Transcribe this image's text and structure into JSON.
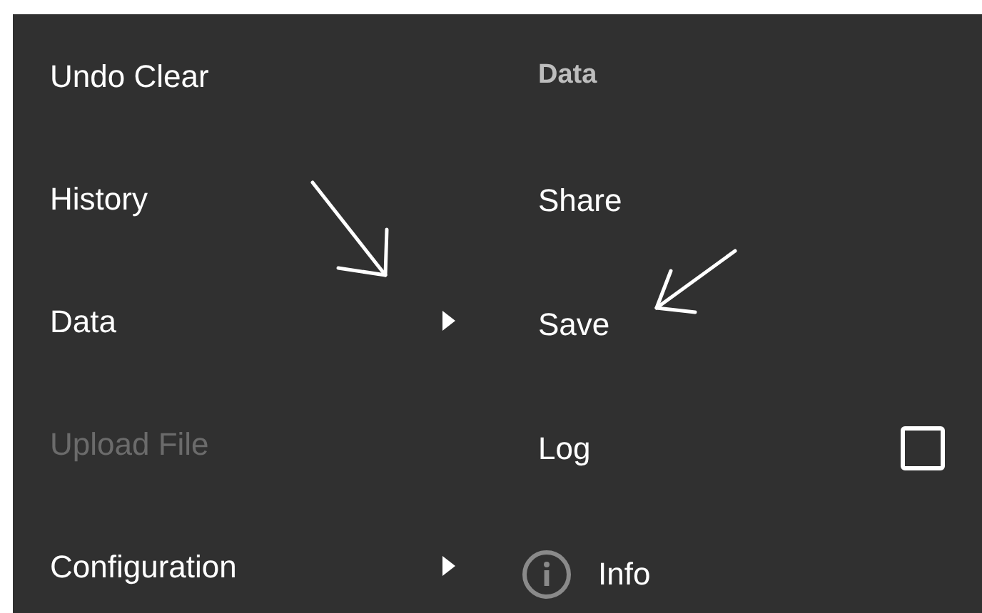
{
  "main_menu": {
    "items": [
      {
        "label": "Undo Clear",
        "kind": "plain",
        "disabled": false
      },
      {
        "label": "History",
        "kind": "plain",
        "disabled": false
      },
      {
        "label": "Data",
        "kind": "submenu",
        "disabled": false
      },
      {
        "label": "Upload File",
        "kind": "plain",
        "disabled": true
      },
      {
        "label": "Configuration",
        "kind": "submenu",
        "disabled": false
      }
    ]
  },
  "submenu": {
    "header": "Data",
    "items": [
      {
        "label": "Share",
        "kind": "plain"
      },
      {
        "label": "Save",
        "kind": "plain"
      },
      {
        "label": "Log",
        "kind": "checkbox",
        "checked": false
      },
      {
        "label": "Info",
        "kind": "info"
      }
    ]
  }
}
